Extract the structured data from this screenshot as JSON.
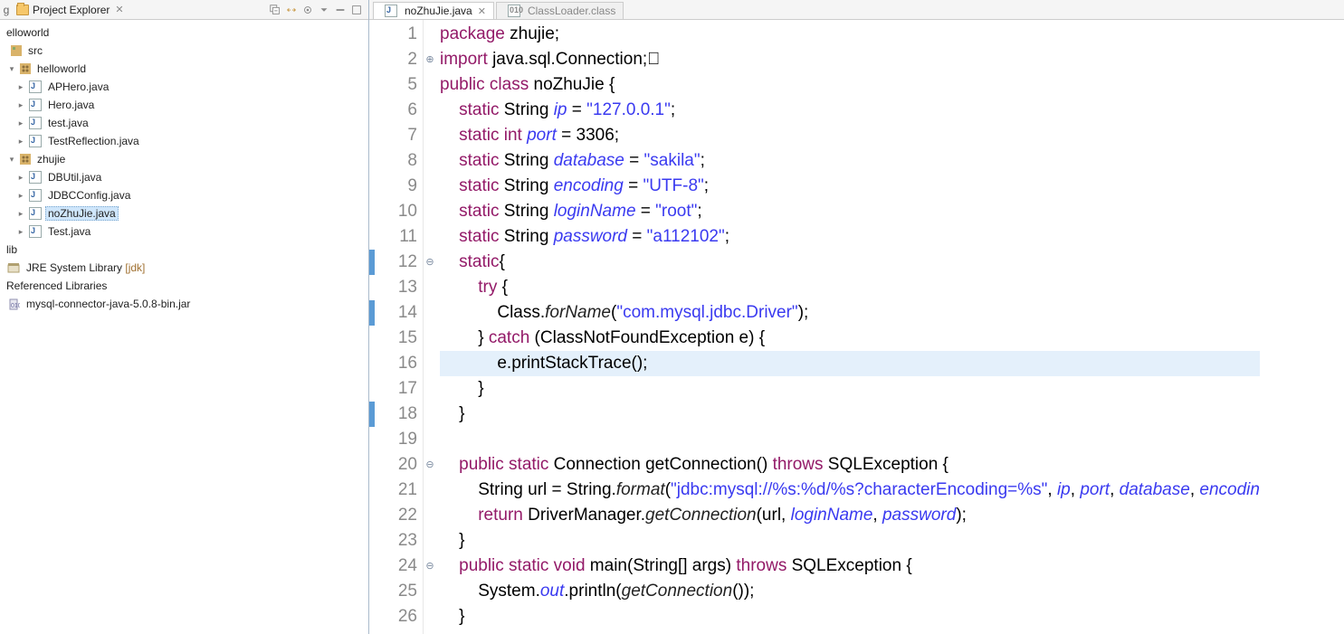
{
  "explorer": {
    "title": "Project Explorer",
    "tree": {
      "project": "elloworld",
      "src": "src",
      "pkg_hello": "helloworld",
      "hello_files": [
        "APHero.java",
        "Hero.java",
        "test.java",
        "TestReflection.java"
      ],
      "pkg_zhujie": "zhujie",
      "zhujie_files": [
        "DBUtil.java",
        "JDBCConfig.java",
        "noZhuJie.java",
        "Test.java"
      ],
      "lib": "lib",
      "jre": "JRE System Library",
      "jre_decor": "[jdk]",
      "ref_lib": "Referenced Libraries",
      "jar": "mysql-connector-java-5.0.8-bin.jar"
    }
  },
  "editor": {
    "tabs": [
      {
        "label": "noZhuJie.java",
        "active": true
      },
      {
        "label": "ClassLoader.class",
        "active": false
      }
    ],
    "lines": [
      {
        "n": "1",
        "fold": "",
        "mark": "",
        "hl": false,
        "tokens": [
          [
            "kw",
            "package"
          ],
          [
            "black",
            " zhujie;"
          ]
        ]
      },
      {
        "n": "2",
        "fold": "⊕",
        "mark": "",
        "hl": false,
        "tokens": [
          [
            "kw",
            "import"
          ],
          [
            "black",
            " java.sql.Connection;⃞"
          ]
        ]
      },
      {
        "n": "5",
        "fold": "",
        "mark": "",
        "hl": false,
        "tokens": [
          [
            "kw",
            "public class"
          ],
          [
            "black",
            " noZhuJie {"
          ]
        ]
      },
      {
        "n": "6",
        "fold": "",
        "mark": "",
        "hl": false,
        "tokens": [
          [
            "black",
            "    "
          ],
          [
            "kw",
            "static"
          ],
          [
            "black",
            " String "
          ],
          [
            "id-italic",
            "ip"
          ],
          [
            "black",
            " = "
          ],
          [
            "str",
            "\"127.0.0.1\""
          ],
          [
            "black",
            ";"
          ]
        ]
      },
      {
        "n": "7",
        "fold": "",
        "mark": "",
        "hl": false,
        "tokens": [
          [
            "black",
            "    "
          ],
          [
            "kw",
            "static int"
          ],
          [
            "black",
            " "
          ],
          [
            "id-italic",
            "port"
          ],
          [
            "black",
            " = 3306;"
          ]
        ]
      },
      {
        "n": "8",
        "fold": "",
        "mark": "",
        "hl": false,
        "tokens": [
          [
            "black",
            "    "
          ],
          [
            "kw",
            "static"
          ],
          [
            "black",
            " String "
          ],
          [
            "id-italic",
            "database"
          ],
          [
            "black",
            " = "
          ],
          [
            "str",
            "\"sakila\""
          ],
          [
            "black",
            ";"
          ]
        ]
      },
      {
        "n": "9",
        "fold": "",
        "mark": "",
        "hl": false,
        "tokens": [
          [
            "black",
            "    "
          ],
          [
            "kw",
            "static"
          ],
          [
            "black",
            " String "
          ],
          [
            "id-italic",
            "encoding"
          ],
          [
            "black",
            " = "
          ],
          [
            "str",
            "\"UTF-8\""
          ],
          [
            "black",
            ";"
          ]
        ]
      },
      {
        "n": "10",
        "fold": "",
        "mark": "",
        "hl": false,
        "tokens": [
          [
            "black",
            "    "
          ],
          [
            "kw",
            "static"
          ],
          [
            "black",
            " String "
          ],
          [
            "id-italic",
            "loginName"
          ],
          [
            "black",
            " = "
          ],
          [
            "str",
            "\"root\""
          ],
          [
            "black",
            ";"
          ]
        ]
      },
      {
        "n": "11",
        "fold": "",
        "mark": "",
        "hl": false,
        "tokens": [
          [
            "black",
            "    "
          ],
          [
            "kw",
            "static"
          ],
          [
            "black",
            " String "
          ],
          [
            "id-italic",
            "password"
          ],
          [
            "black",
            " = "
          ],
          [
            "str",
            "\"a112102\""
          ],
          [
            "black",
            ";"
          ]
        ]
      },
      {
        "n": "12",
        "fold": "⊖",
        "mark": "blue",
        "hl": false,
        "tokens": [
          [
            "black",
            "    "
          ],
          [
            "kw",
            "static"
          ],
          [
            "black",
            "{"
          ]
        ]
      },
      {
        "n": "13",
        "fold": "",
        "mark": "",
        "hl": false,
        "tokens": [
          [
            "black",
            "        "
          ],
          [
            "kw",
            "try"
          ],
          [
            "black",
            " {"
          ]
        ]
      },
      {
        "n": "14",
        "fold": "",
        "mark": "blue",
        "hl": false,
        "tokens": [
          [
            "black",
            "            Class."
          ],
          [
            "call-italic",
            "forName"
          ],
          [
            "black",
            "("
          ],
          [
            "str",
            "\"com.mysql.jdbc.Driver\""
          ],
          [
            "black",
            ");"
          ]
        ]
      },
      {
        "n": "15",
        "fold": "",
        "mark": "",
        "hl": false,
        "tokens": [
          [
            "black",
            "        } "
          ],
          [
            "kw",
            "catch"
          ],
          [
            "black",
            " (ClassNotFoundException e) {"
          ]
        ]
      },
      {
        "n": "16",
        "fold": "",
        "mark": "",
        "hl": true,
        "tokens": [
          [
            "black",
            "            e.printStackTrace();"
          ]
        ]
      },
      {
        "n": "17",
        "fold": "",
        "mark": "",
        "hl": false,
        "tokens": [
          [
            "black",
            "        }"
          ]
        ]
      },
      {
        "n": "18",
        "fold": "",
        "mark": "blue",
        "hl": false,
        "tokens": [
          [
            "black",
            "    }"
          ]
        ]
      },
      {
        "n": "19",
        "fold": "",
        "mark": "",
        "hl": false,
        "tokens": [
          [
            "black",
            ""
          ]
        ]
      },
      {
        "n": "20",
        "fold": "⊖",
        "mark": "",
        "hl": false,
        "tokens": [
          [
            "black",
            "    "
          ],
          [
            "kw",
            "public static"
          ],
          [
            "black",
            " Connection getConnection() "
          ],
          [
            "kw",
            "throws"
          ],
          [
            "black",
            " SQLException {"
          ]
        ]
      },
      {
        "n": "21",
        "fold": "",
        "mark": "",
        "hl": false,
        "tokens": [
          [
            "black",
            "        String url = String."
          ],
          [
            "call-italic",
            "format"
          ],
          [
            "black",
            "("
          ],
          [
            "str",
            "\"jdbc:mysql://%s:%d/%s?characterEncoding=%s\""
          ],
          [
            "black",
            ", "
          ],
          [
            "id-italic",
            "ip"
          ],
          [
            "black",
            ", "
          ],
          [
            "id-italic",
            "port"
          ],
          [
            "black",
            ", "
          ],
          [
            "id-italic",
            "database"
          ],
          [
            "black",
            ", "
          ],
          [
            "id-italic",
            "encodin"
          ]
        ]
      },
      {
        "n": "22",
        "fold": "",
        "mark": "",
        "hl": false,
        "tokens": [
          [
            "black",
            "        "
          ],
          [
            "kw",
            "return"
          ],
          [
            "black",
            " DriverManager."
          ],
          [
            "call-italic",
            "getConnection"
          ],
          [
            "black",
            "(url, "
          ],
          [
            "id-italic",
            "loginName"
          ],
          [
            "black",
            ", "
          ],
          [
            "id-italic",
            "password"
          ],
          [
            "black",
            ");"
          ]
        ]
      },
      {
        "n": "23",
        "fold": "",
        "mark": "",
        "hl": false,
        "tokens": [
          [
            "black",
            "    }"
          ]
        ]
      },
      {
        "n": "24",
        "fold": "⊖",
        "mark": "",
        "hl": false,
        "tokens": [
          [
            "black",
            "    "
          ],
          [
            "kw",
            "public static void"
          ],
          [
            "black",
            " main(String[] args) "
          ],
          [
            "kw",
            "throws"
          ],
          [
            "black",
            " SQLException {"
          ]
        ]
      },
      {
        "n": "25",
        "fold": "",
        "mark": "",
        "hl": false,
        "tokens": [
          [
            "black",
            "        System."
          ],
          [
            "id-italic",
            "out"
          ],
          [
            "black",
            ".println("
          ],
          [
            "call-italic",
            "getConnection"
          ],
          [
            "black",
            "());"
          ]
        ]
      },
      {
        "n": "26",
        "fold": "",
        "mark": "",
        "hl": false,
        "tokens": [
          [
            "black",
            "    }"
          ]
        ]
      }
    ]
  },
  "left_tab_label": "g"
}
